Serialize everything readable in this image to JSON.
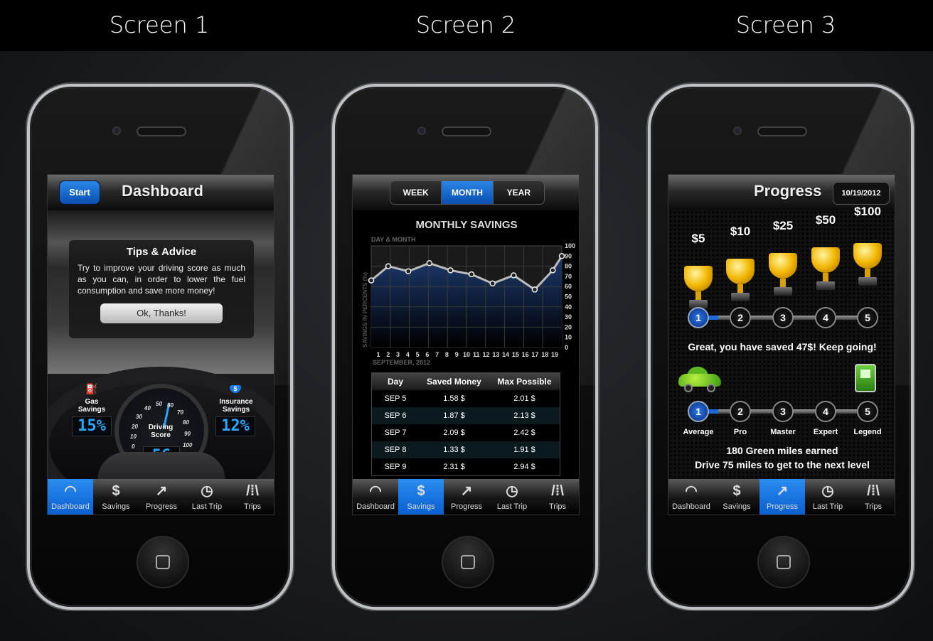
{
  "labels": [
    "Screen 1",
    "Screen 2",
    "Screen 3"
  ],
  "tabs": [
    {
      "label": "Dashboard",
      "icon": "speedometer-icon"
    },
    {
      "label": "Savings",
      "icon": "dollar-icon"
    },
    {
      "label": "Progress",
      "icon": "trend-up-arrow-icon"
    },
    {
      "label": "Last Trip",
      "icon": "history-clock-icon"
    },
    {
      "label": "Trips",
      "icon": "road-icon"
    }
  ],
  "tab_glyphs": [
    "◠",
    "$",
    "↗",
    "◷",
    "/⁞\\"
  ],
  "accent": "#1a7ae8",
  "screen1": {
    "start_label": "Start",
    "title": "Dashboard",
    "tips_title": "Tips & Advice",
    "tips_text": "Try to improve your driving score as much as you can, in order to lower the fuel consumption and save more money!",
    "ok_label": "Ok, Thanks!",
    "gas_label": "Gas Savings",
    "gas_value": "15%",
    "score_label": "Driving Score",
    "score_value": "56",
    "insurance_label": "Insurance Savings",
    "insurance_value": "12%",
    "gauge_ticks": [
      "0",
      "10",
      "20",
      "30",
      "40",
      "50",
      "60",
      "70",
      "80",
      "90",
      "100"
    ]
  },
  "screen2": {
    "segments": [
      "WEEK",
      "MONTH",
      "YEAR"
    ],
    "selected_segment": "MONTH",
    "table": {
      "headers": [
        "Day",
        "Saved Money",
        "Max Possible"
      ],
      "rows": [
        [
          "SEP 5",
          "1.58 $",
          "2.01 $"
        ],
        [
          "SEP 6",
          "1.87 $",
          "2.13 $"
        ],
        [
          "SEP 7",
          "2.09 $",
          "2.42 $"
        ],
        [
          "SEP 8",
          "1.33 $",
          "1.91 $"
        ],
        [
          "SEP 9",
          "2.31 $",
          "2.94 $"
        ]
      ]
    }
  },
  "chart_data": {
    "type": "area",
    "title": "MONTHLY SAVINGS",
    "subtitle": "DAY & MONTH",
    "xlabel": "SEPTEMBER, 2012",
    "ylabel": "SAVINGS IN PERCENTS (%)",
    "x_ticks": [
      1,
      2,
      3,
      4,
      5,
      6,
      7,
      8,
      9,
      10,
      11,
      12,
      13,
      14,
      15,
      16,
      17,
      18,
      19
    ],
    "y_ticks": [
      0,
      10,
      20,
      30,
      40,
      50,
      60,
      70,
      80,
      90,
      100
    ],
    "xlim": [
      0.6,
      19.6
    ],
    "ylim": [
      0,
      100
    ],
    "grid": true,
    "x": [
      0.6,
      2.3,
      4.3,
      6.4,
      8.5,
      10.6,
      12.7,
      14.8,
      16.9,
      18.7,
      19.6
    ],
    "values": [
      66,
      80,
      75,
      83,
      76,
      72,
      63,
      71,
      57,
      76,
      90
    ],
    "fill_color": "#1c3a6e",
    "line_color": "#bbbbbb"
  },
  "screen3": {
    "title": "Progress",
    "date": "10/19/2012",
    "prizes": [
      "$5",
      "$10",
      "$25",
      "$50",
      "$100"
    ],
    "steps": [
      "1",
      "2",
      "3",
      "4",
      "5"
    ],
    "current_step": 1,
    "saved_message": "Great, you have saved 47$! Keep going!",
    "levels": [
      "Average",
      "Pro",
      "Master",
      "Expert",
      "Legend"
    ],
    "current_level": 1,
    "miles_earned": "180 Green miles earned",
    "next_level": "Drive 75 miles to get to the next level"
  }
}
